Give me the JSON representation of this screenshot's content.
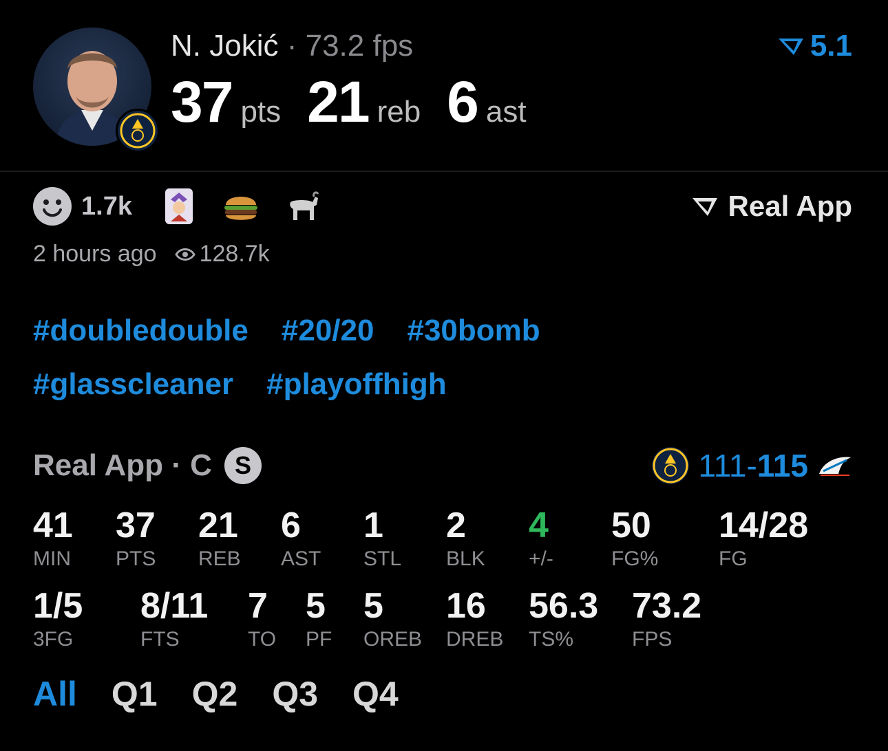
{
  "player": {
    "name": "N. Jokić",
    "separator": "·",
    "fps_text": "73.2 fps",
    "rating": "5.1",
    "big_stats": [
      {
        "value": "37",
        "unit": "pts"
      },
      {
        "value": "21",
        "unit": "reb"
      },
      {
        "value": "6",
        "unit": "ast"
      }
    ]
  },
  "reactions": {
    "count": "1.7k",
    "emojis": [
      "joker-card-icon",
      "burger-icon",
      "goat-icon"
    ],
    "source_button": "Real App"
  },
  "meta": {
    "time": "2 hours ago",
    "views": "128.7k"
  },
  "hashtags": {
    "row1": [
      "#doubledouble",
      "#20/20",
      "#30bomb"
    ],
    "row2": [
      "#glasscleaner",
      "#playoffhigh"
    ]
  },
  "game": {
    "header": "Real App · C",
    "badge": "S",
    "score_home": "111",
    "score_sep": "-",
    "score_away": "115"
  },
  "stats": {
    "row1": [
      {
        "value": "41",
        "label": "MIN"
      },
      {
        "value": "37",
        "label": "PTS"
      },
      {
        "value": "21",
        "label": "REB"
      },
      {
        "value": "6",
        "label": "AST"
      },
      {
        "value": "1",
        "label": "STL"
      },
      {
        "value": "2",
        "label": "BLK"
      },
      {
        "value": "4",
        "label": "+/-"
      },
      {
        "value": "50",
        "label": "FG%"
      },
      {
        "value": "14/28",
        "label": "FG"
      }
    ],
    "row2": [
      {
        "value": "1/5",
        "label": "3FG"
      },
      {
        "value": "8/11",
        "label": "FTS"
      },
      {
        "value": "7",
        "label": "TO"
      },
      {
        "value": "5",
        "label": "PF"
      },
      {
        "value": "5",
        "label": "OREB"
      },
      {
        "value": "16",
        "label": "DREB"
      },
      {
        "value": "56.3",
        "label": "TS%"
      },
      {
        "value": "73.2",
        "label": "FPS"
      }
    ]
  },
  "tabs": [
    "All",
    "Q1",
    "Q2",
    "Q3",
    "Q4"
  ],
  "colors": {
    "accent": "#1e8bdc",
    "positive": "#2eb85c",
    "muted": "#8e8e93"
  }
}
